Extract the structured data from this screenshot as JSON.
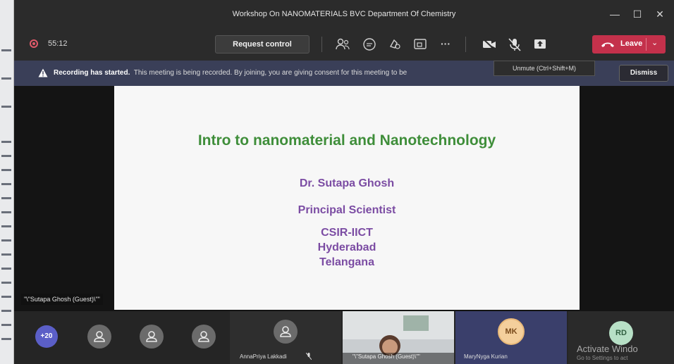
{
  "window": {
    "title": "Workshop On NANOMATERIALS BVC Department Of Chemistry",
    "minimize_glyph": "—",
    "maximize_glyph": "☐",
    "close_glyph": "✕"
  },
  "toolbar": {
    "timer": "55:12",
    "request_control_label": "Request control",
    "more_glyph": "···",
    "leave_label": "Leave",
    "leave_chevron": "⌄",
    "icons": [
      "participants-icon",
      "chat-icon",
      "reactions-icon",
      "share-tray-icon",
      "more-icon",
      "camera-off-icon",
      "mic-muted-icon",
      "share-screen-icon"
    ]
  },
  "banner": {
    "bold_text": "Recording has started.",
    "text": "This meeting is being recorded. By joining, you are giving consent for this meeting to be",
    "dismiss_label": "Dismiss"
  },
  "tooltip": {
    "text": "Unmute (Ctrl+Shift+M)"
  },
  "slide": {
    "title": "Intro to nanomaterial and Nanotechnology",
    "lines": [
      "Dr. Sutapa Ghosh",
      "Principal Scientist",
      "CSIR-IICT",
      "Hyderabad",
      "Telangana"
    ]
  },
  "speaker_label": "\"\\\"Sutapa Ghosh (Guest)\\\"\"",
  "participants": {
    "overflow_count": "+20",
    "tiles": [
      {
        "name": "AnnaPriya Lakkadi"
      },
      {
        "name": "\"\\\"Sutapa Ghosh (Guest)\\\"\""
      },
      {
        "name": "MaryNyga Kurian",
        "initials": "MK"
      },
      {
        "initials": "RD"
      }
    ]
  },
  "watermark": {
    "title": "Activate Windo",
    "sub": "Go to Settings to act"
  },
  "colors": {
    "leave": "#c4314b",
    "banner": "#3a3f58",
    "slide_title": "#3f8e3a",
    "slide_text": "#7b4ca3",
    "overflow_badge": "#5b5fc7"
  }
}
